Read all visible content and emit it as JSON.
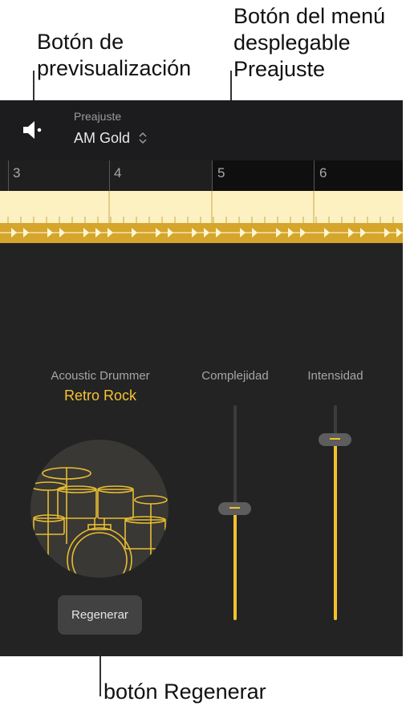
{
  "callouts": {
    "preview": [
      "Botón de",
      "previsualización"
    ],
    "preset_menu": [
      "Botón del menú",
      "desplegable",
      "Preajuste"
    ],
    "regenerate": "botón Regenerar"
  },
  "header": {
    "preview_icon": "speaker-icon",
    "preset_label": "Preajuste",
    "preset_value": "AM Gold",
    "preset_chevron_icon": "up-down-chevron-icon"
  },
  "ruler": {
    "bars": [
      "3",
      "4",
      "5",
      "6"
    ]
  },
  "drummer": {
    "label": "Acoustic Drummer",
    "name": "Retro Rock",
    "image_icon": "drum-kit-icon"
  },
  "sliders": {
    "complexity": {
      "label": "Complejidad",
      "level": 0.52
    },
    "intensity": {
      "label": "Intensidad",
      "level": 0.84
    }
  },
  "regenerate_button": "Regenerar",
  "colors": {
    "accent": "#f3c12b",
    "panel_bg": "#232323",
    "region_light": "#fdf1c2",
    "region_dark": "#d5a52c"
  }
}
